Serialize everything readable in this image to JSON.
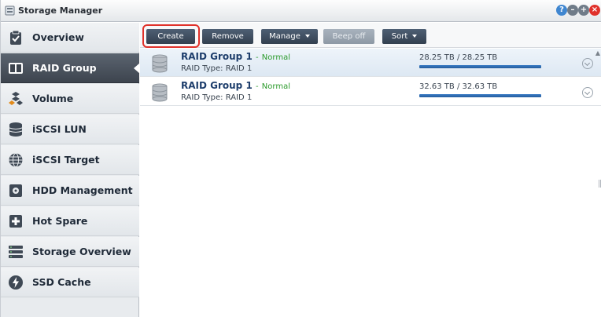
{
  "window": {
    "title": "Storage Manager",
    "controls": [
      "help-icon",
      "minimize-icon",
      "maximize-icon",
      "close-icon"
    ]
  },
  "sidebar": {
    "items": [
      {
        "label": "Overview",
        "icon": "clipboard-check-icon",
        "active": false
      },
      {
        "label": "RAID Group",
        "icon": "raid-group-icon",
        "active": true
      },
      {
        "label": "Volume",
        "icon": "volume-icon",
        "active": false
      },
      {
        "label": "iSCSI LUN",
        "icon": "iscsi-lun-icon",
        "active": false
      },
      {
        "label": "iSCSI Target",
        "icon": "globe-icon",
        "active": false
      },
      {
        "label": "HDD Management",
        "icon": "hdd-icon",
        "active": false
      },
      {
        "label": "Hot Spare",
        "icon": "hot-spare-icon",
        "active": false
      },
      {
        "label": "Storage Overview",
        "icon": "rack-icon",
        "active": false
      },
      {
        "label": "SSD Cache",
        "icon": "lightning-icon",
        "active": false
      }
    ]
  },
  "toolbar": {
    "create": "Create",
    "remove": "Remove",
    "manage": "Manage",
    "beep_off": "Beep off",
    "sort": "Sort"
  },
  "raid_groups": [
    {
      "name": "RAID Group 1",
      "separator": "-",
      "status": "Normal",
      "type": "RAID Type: RAID 1",
      "capacity": "28.25 TB / 28.25 TB",
      "usage": 1.0
    },
    {
      "name": "RAID Group 1",
      "separator": "-",
      "status": "Normal",
      "type": "RAID Type: RAID 1",
      "capacity": "32.63 TB / 32.63 TB",
      "usage": 1.0
    }
  ],
  "colors": {
    "accent": "#245c9c",
    "status_normal": "#2c9b2c",
    "highlight": "#e0312a",
    "sidebar_active": "#3d444e"
  }
}
